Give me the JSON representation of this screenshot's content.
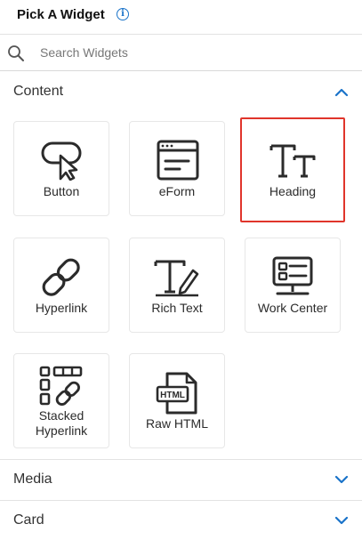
{
  "header": {
    "title": "Pick A Widget",
    "info_glyph": "i"
  },
  "search": {
    "placeholder": "Search Widgets"
  },
  "sections": [
    {
      "label": "Content",
      "expanded": true
    },
    {
      "label": "Media",
      "expanded": false
    },
    {
      "label": "Card",
      "expanded": false
    }
  ],
  "content": {
    "tiles": [
      {
        "label": "Button",
        "icon": "button-icon",
        "selected": false
      },
      {
        "label": "eForm",
        "icon": "eform-icon",
        "selected": false
      },
      {
        "label": "Heading",
        "icon": "heading-icon",
        "selected": true
      },
      {
        "label": "Hyperlink",
        "icon": "hyperlink-icon",
        "selected": false
      },
      {
        "label": "Rich Text",
        "icon": "rich-text-icon",
        "selected": false
      },
      {
        "label": "Work Center",
        "icon": "work-center-icon",
        "selected": false
      },
      {
        "label": "Stacked",
        "label2": "Hyperlink",
        "icon": "stacked-hyperlink-icon",
        "selected": false
      },
      {
        "label": "Raw HTML",
        "icon": "raw-html-icon",
        "selected": false,
        "icon_text": "HTML"
      }
    ]
  },
  "colors": {
    "accent": "#1a73c9",
    "selected_border": "#e0352b",
    "icon": "#2b2b2b"
  }
}
